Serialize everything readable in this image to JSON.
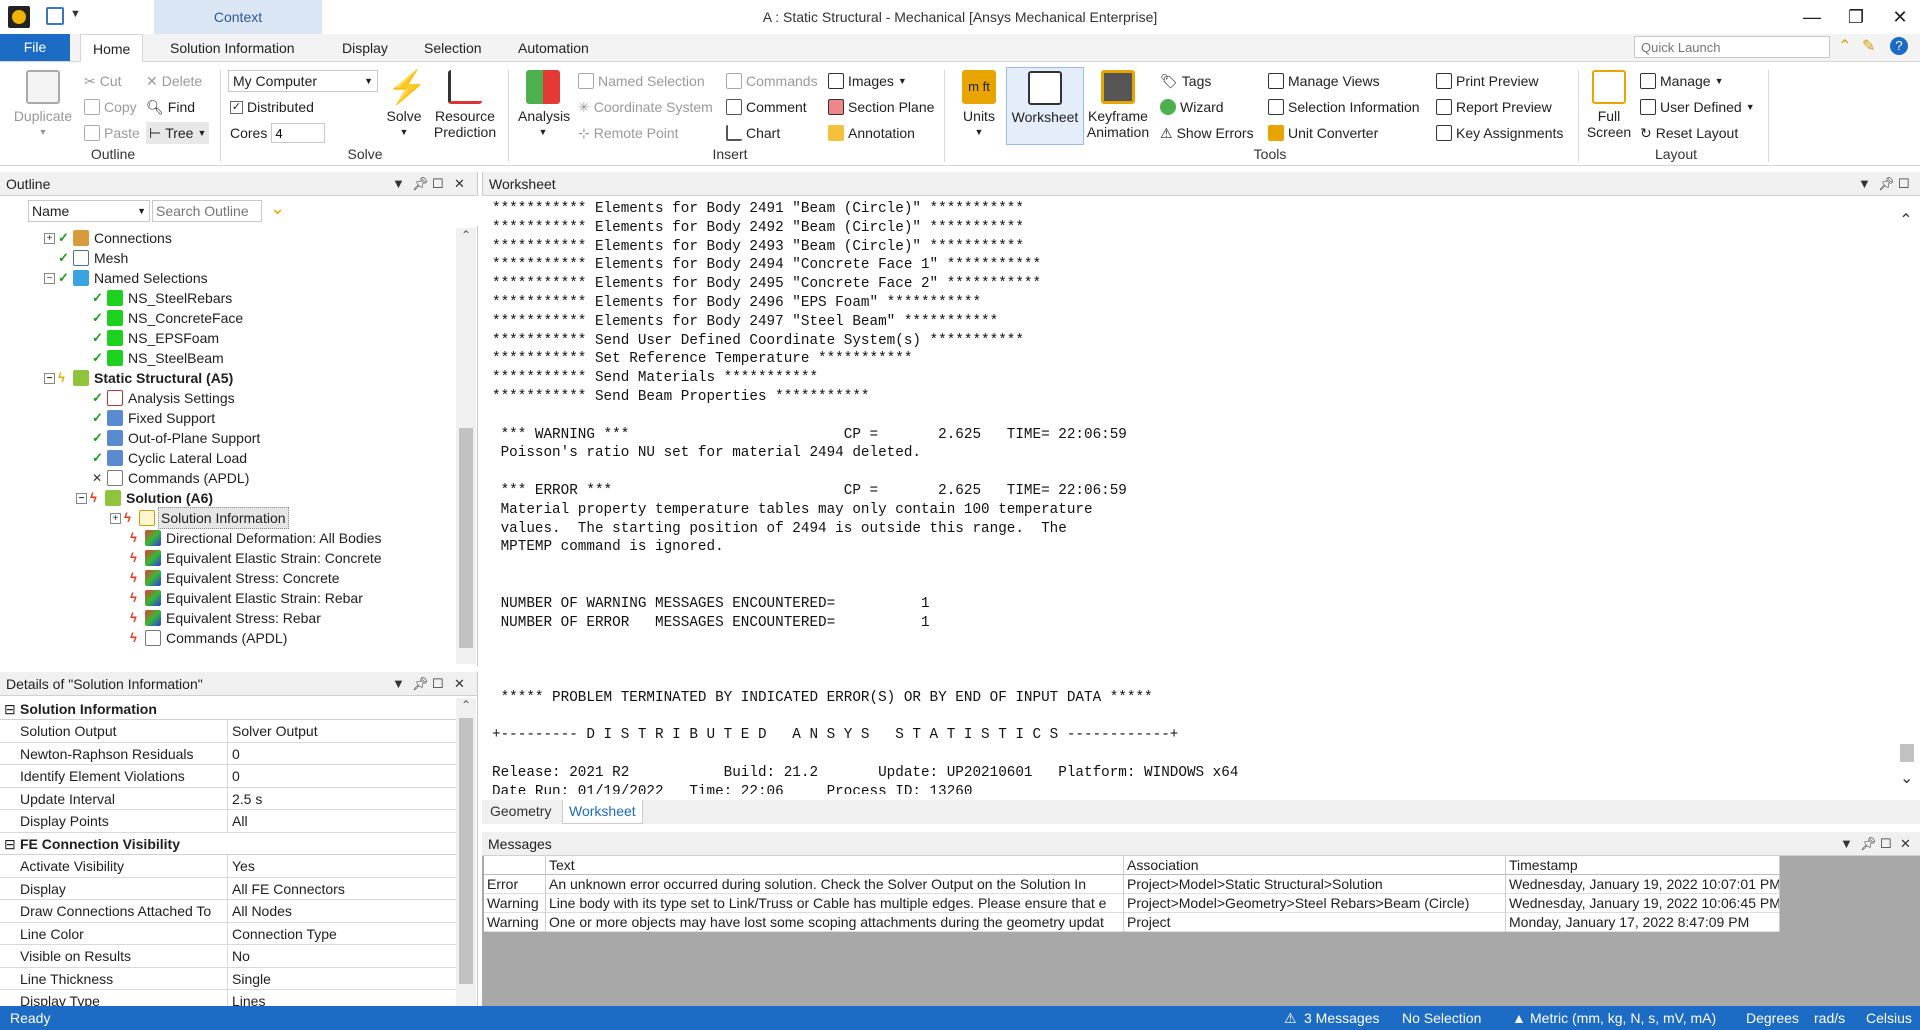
{
  "window": {
    "title": "A : Static Structural - Mechanical [Ansys Mechanical Enterprise]",
    "context_tab": "Context"
  },
  "tabs": {
    "file": "File",
    "items": [
      "Home",
      "Solution Information",
      "Display",
      "Selection",
      "Automation"
    ]
  },
  "quick_launch": {
    "placeholder": "Quick Launch"
  },
  "ribbon": {
    "outline": {
      "label": "Outline",
      "duplicate": "Duplicate",
      "cut": "Cut",
      "copy": "Copy",
      "paste": "Paste",
      "delete": "Delete",
      "find": "Find",
      "tree": "Tree"
    },
    "solve": {
      "label": "Solve",
      "computer": "My Computer",
      "distributed": "Distributed",
      "cores_label": "Cores",
      "cores_value": "4",
      "solve": "Solve",
      "resource": "Resource",
      "prediction": "Prediction"
    },
    "insert": {
      "label": "Insert",
      "analysis": "Analysis",
      "named_selection": "Named Selection",
      "coordinate_system": "Coordinate System",
      "remote_point": "Remote Point",
      "commands": "Commands",
      "comment": "Comment",
      "chart": "Chart",
      "images": "Images",
      "section_plane": "Section Plane",
      "annotation": "Annotation"
    },
    "tools": {
      "label": "Tools",
      "units": "Units",
      "worksheet": "Worksheet",
      "keyframe": "Keyframe",
      "animation": "Animation",
      "tags": "Tags",
      "wizard": "Wizard",
      "show_errors": "Show Errors",
      "manage_views": "Manage Views",
      "selection_information": "Selection Information",
      "unit_converter": "Unit Converter",
      "print_preview": "Print Preview",
      "report_preview": "Report Preview",
      "key_assignments": "Key Assignments"
    },
    "layout": {
      "label": "Layout",
      "full": "Full",
      "screen": "Screen",
      "manage": "Manage",
      "user_defined": "User Defined",
      "reset_layout": "Reset Layout"
    }
  },
  "outline": {
    "title": "Outline",
    "filter_field": "Name",
    "search_placeholder": "Search Outline",
    "nodes": [
      {
        "label": "Connections"
      },
      {
        "label": "Mesh"
      },
      {
        "label": "Named Selections"
      },
      {
        "label": "NS_SteelRebars"
      },
      {
        "label": "NS_ConcreteFace"
      },
      {
        "label": "NS_EPSFoam"
      },
      {
        "label": "NS_SteelBeam"
      },
      {
        "label": "Static Structural (A5)"
      },
      {
        "label": "Analysis Settings"
      },
      {
        "label": "Fixed Support"
      },
      {
        "label": "Out-of-Plane Support"
      },
      {
        "label": "Cyclic Lateral Load"
      },
      {
        "label": "Commands (APDL)"
      },
      {
        "label": "Solution (A6)"
      },
      {
        "label": "Solution Information"
      },
      {
        "label": "Directional Deformation: All Bodies"
      },
      {
        "label": "Equivalent Elastic Strain: Concrete"
      },
      {
        "label": "Equivalent Stress: Concrete"
      },
      {
        "label": "Equivalent Elastic Strain: Rebar"
      },
      {
        "label": "Equivalent Stress: Rebar"
      },
      {
        "label": "Commands (APDL)"
      }
    ]
  },
  "details": {
    "title": "Details of \"Solution Information\"",
    "groups": [
      {
        "name": "Solution Information",
        "rows": [
          [
            "Solution Output",
            "Solver Output"
          ],
          [
            "Newton-Raphson Residuals",
            "0"
          ],
          [
            "Identify Element Violations",
            "0"
          ],
          [
            "Update Interval",
            "2.5 s"
          ],
          [
            "Display Points",
            "All"
          ]
        ]
      },
      {
        "name": "FE Connection Visibility",
        "rows": [
          [
            "Activate Visibility",
            "Yes"
          ],
          [
            "Display",
            "All FE Connectors"
          ],
          [
            "Draw Connections Attached To",
            "All Nodes"
          ],
          [
            "Line Color",
            "Connection Type"
          ],
          [
            "Visible on Results",
            "No"
          ],
          [
            "Line Thickness",
            "Single"
          ],
          [
            "Display Type",
            "Lines"
          ]
        ]
      }
    ]
  },
  "worksheet": {
    "title": "Worksheet",
    "lines": [
      "*********** Elements for Body 2491 \"Beam (Circle)\" ***********",
      "*********** Elements for Body 2492 \"Beam (Circle)\" ***********",
      "*********** Elements for Body 2493 \"Beam (Circle)\" ***********",
      "*********** Elements for Body 2494 \"Concrete Face 1\" ***********",
      "*********** Elements for Body 2495 \"Concrete Face 2\" ***********",
      "*********** Elements for Body 2496 \"EPS Foam\" ***********",
      "*********** Elements for Body 2497 \"Steel Beam\" ***********",
      "*********** Send User Defined Coordinate System(s) ***********",
      "*********** Set Reference Temperature ***********",
      "*********** Send Materials ***********",
      "*********** Send Beam Properties ***********",
      "",
      " *** WARNING ***                         CP =       2.625   TIME= 22:06:59",
      " Poisson's ratio NU set for material 2494 deleted.",
      "",
      " *** ERROR ***                           CP =       2.625   TIME= 22:06:59",
      " Material property temperature tables may only contain 100 temperature",
      " values.  The starting position of 2494 is outside this range.  The",
      " MPTEMP command is ignored.",
      "",
      "",
      " NUMBER OF WARNING MESSAGES ENCOUNTERED=          1",
      " NUMBER OF ERROR   MESSAGES ENCOUNTERED=          1",
      "",
      "",
      "",
      " ***** PROBLEM TERMINATED BY INDICATED ERROR(S) OR BY END OF INPUT DATA *****",
      "",
      "+--------- D I S T R I B U T E D   A N S Y S   S T A T I S T I C S ------------+",
      "",
      "Release: 2021 R2           Build: 21.2       Update: UP20210601   Platform: WINDOWS x64",
      "Date Run: 01/19/2022   Time: 22:06     Process ID: 13260"
    ],
    "tabs": [
      "Geometry",
      "Worksheet"
    ]
  },
  "messages": {
    "title": "Messages",
    "columns": [
      "Text",
      "Association",
      "Timestamp"
    ],
    "rows": [
      [
        "Error",
        "An unknown error occurred during solution.  Check the Solver Output on the Solution In",
        "Project>Model>Static Structural>Solution",
        "Wednesday, January 19, 2022 10:07:01 PM"
      ],
      [
        "Warning",
        "Line body with its type set to Link/Truss or Cable has multiple edges. Please ensure that e",
        "Project>Model>Geometry>Steel Rebars>Beam (Circle)",
        "Wednesday, January 19, 2022 10:06:45 PM"
      ],
      [
        "Warning",
        "One or more objects may have lost some scoping attachments during the geometry updat",
        "Project",
        "Monday, January 17, 2022 8:47:09 PM"
      ]
    ]
  },
  "status": {
    "ready": "Ready",
    "messages": "3 Messages",
    "selection": "No Selection",
    "units": "Metric (mm, kg, N, s, mV, mA)",
    "degrees": "Degrees",
    "rads": "rad/s",
    "temp": "Celsius"
  }
}
